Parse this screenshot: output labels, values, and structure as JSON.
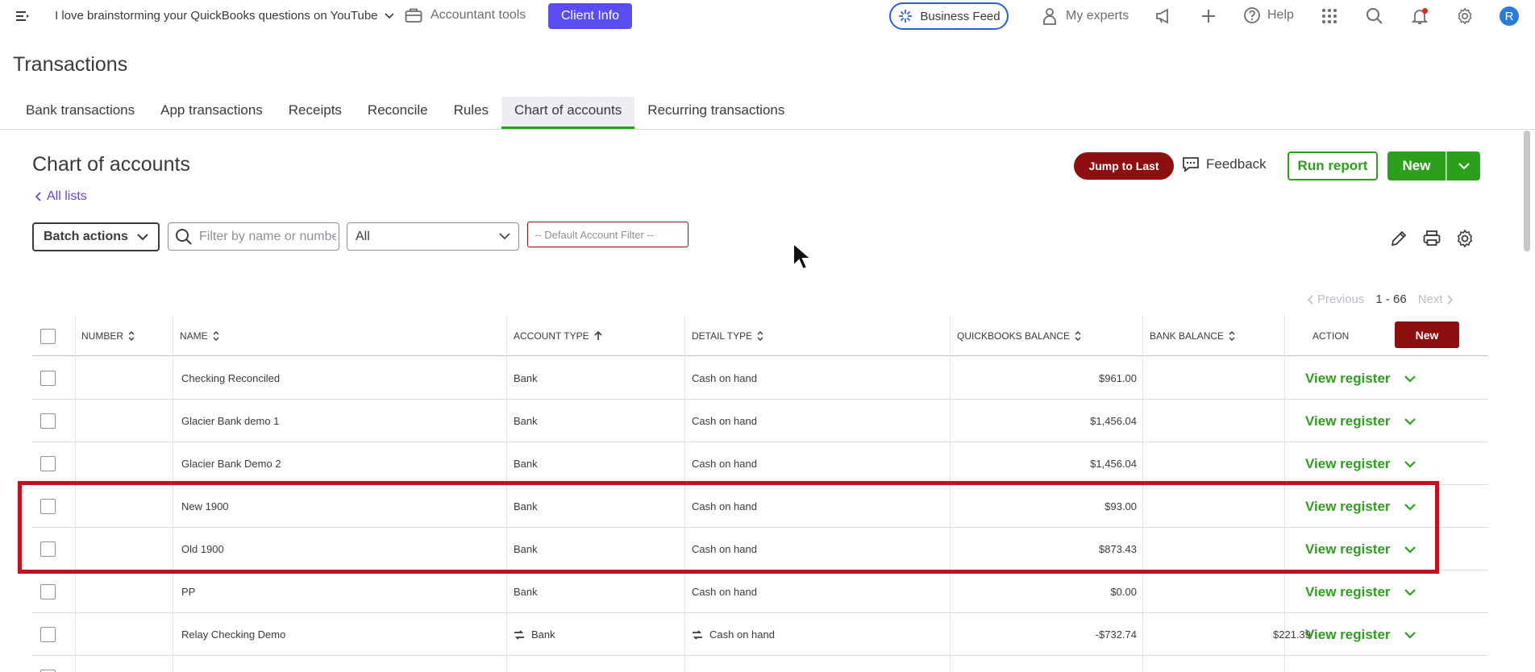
{
  "topbar": {
    "company_name": "I love brainstorming your QuickBooks questions on YouTube",
    "accountant_tools": "Accountant tools",
    "client_info": "Client Info",
    "business_feed": "Business Feed",
    "my_experts": "My experts",
    "help": "Help",
    "avatar_initial": "R"
  },
  "page": {
    "title": "Transactions",
    "tabs": [
      {
        "label": "Bank transactions",
        "active": false
      },
      {
        "label": "App transactions",
        "active": false
      },
      {
        "label": "Receipts",
        "active": false
      },
      {
        "label": "Reconcile",
        "active": false
      },
      {
        "label": "Rules",
        "active": false
      },
      {
        "label": "Chart of accounts",
        "active": true
      },
      {
        "label": "Recurring transactions",
        "active": false
      }
    ]
  },
  "section": {
    "title": "Chart of accounts",
    "all_lists": "All lists",
    "jump_to_last": "Jump to Last",
    "feedback": "Feedback",
    "run_report": "Run report",
    "new": "New"
  },
  "filters": {
    "batch_actions": "Batch actions",
    "search_placeholder": "Filter by name or number",
    "type_value": "All",
    "default_filter": "-- Default Account Filter --"
  },
  "pagination": {
    "previous": "Previous",
    "range": "1 - 66",
    "next": "Next"
  },
  "table": {
    "headers": {
      "number": "NUMBER",
      "name": "NAME",
      "account_type": "ACCOUNT TYPE",
      "detail_type": "DETAIL TYPE",
      "qb_balance": "QUICKBOOKS BALANCE",
      "bank_balance": "BANK BALANCE",
      "action": "ACTION",
      "new": "New"
    },
    "action_label": "View register",
    "rows": [
      {
        "number": "",
        "name": "Checking Reconciled",
        "account_type": "Bank",
        "detail_type": "Cash on hand",
        "qb_balance": "$961.00",
        "bank_balance": "",
        "linked": false
      },
      {
        "number": "",
        "name": "Glacier Bank demo 1",
        "account_type": "Bank",
        "detail_type": "Cash on hand",
        "qb_balance": "$1,456.04",
        "bank_balance": "",
        "linked": false
      },
      {
        "number": "",
        "name": "Glacier Bank Demo 2",
        "account_type": "Bank",
        "detail_type": "Cash on hand",
        "qb_balance": "$1,456.04",
        "bank_balance": "",
        "linked": false
      },
      {
        "number": "",
        "name": "New 1900",
        "account_type": "Bank",
        "detail_type": "Cash on hand",
        "qb_balance": "$93.00",
        "bank_balance": "",
        "linked": false
      },
      {
        "number": "",
        "name": "Old 1900",
        "account_type": "Bank",
        "detail_type": "Cash on hand",
        "qb_balance": "$873.43",
        "bank_balance": "",
        "linked": false
      },
      {
        "number": "",
        "name": "PP",
        "account_type": "Bank",
        "detail_type": "Cash on hand",
        "qb_balance": "$0.00",
        "bank_balance": "",
        "linked": false
      },
      {
        "number": "",
        "name": "Relay Checking Demo",
        "account_type": "Bank",
        "detail_type": "Cash on hand",
        "qb_balance": "-$732.74",
        "bank_balance": "$221.39",
        "linked": true
      }
    ]
  },
  "colors": {
    "brand_green": "#2ca01c",
    "maroon": "#8e0f0f",
    "highlight_red": "#c1121f",
    "client_info_purple": "#5a4df0"
  }
}
